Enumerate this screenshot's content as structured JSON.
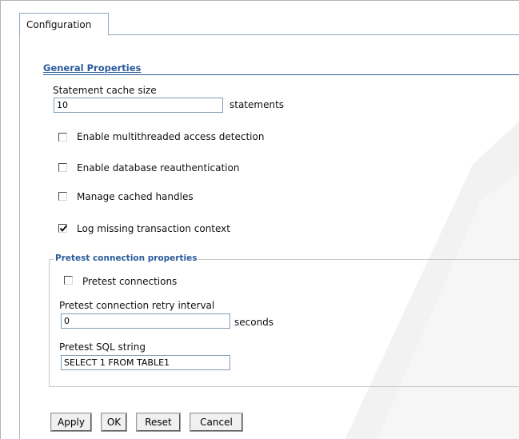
{
  "tab": {
    "label": "Configuration"
  },
  "general": {
    "title": "General Properties",
    "cache_label": "Statement cache size",
    "cache_value": "10",
    "cache_unit": "statements",
    "options": [
      {
        "label": "Enable multithreaded access detection",
        "checked": false
      },
      {
        "label": "Enable database reauthentication",
        "checked": false
      },
      {
        "label": "Manage cached handles",
        "checked": false
      },
      {
        "label": "Log missing transaction context",
        "checked": true
      }
    ]
  },
  "pretest": {
    "legend": "Pretest connection properties",
    "connections_label": "Pretest connections",
    "connections_checked": false,
    "retry_label": "Pretest connection retry interval",
    "retry_value": "0",
    "retry_unit": "seconds",
    "sql_label": "Pretest SQL string",
    "sql_value": "SELECT 1 FROM TABLE1"
  },
  "buttons": {
    "apply": "Apply",
    "ok": "OK",
    "reset": "Reset",
    "cancel": "Cancel"
  }
}
